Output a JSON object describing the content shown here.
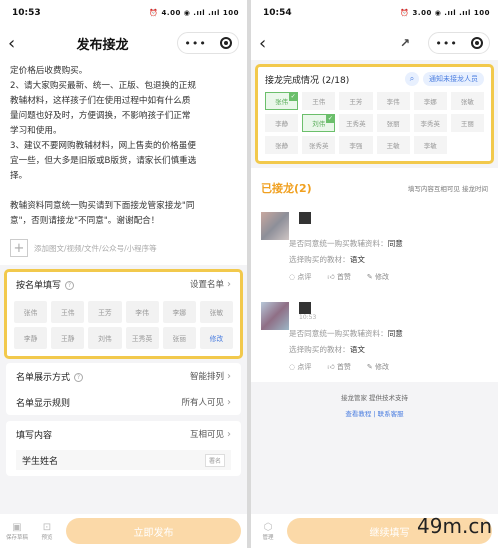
{
  "left": {
    "status": {
      "time": "10:53",
      "icons": "⏰ 4.00 ◉ .ııl .ııl 100"
    },
    "title": "发布接龙",
    "body_lines": [
      "定价格后收费购买。",
      "2、请大家购买最新、统一、正版、包退换的正规",
      "教辅材料，这样孩子们在使用过程中如有什么质",
      "量问题也好及时，方便调换，不影响孩子们正常",
      "学习和使用。",
      "3、建议不要网购教辅材料，网上售卖的价格虽便",
      "宜一些，但大多是旧版或B版货，请家长们慎重选",
      "择。",
      "",
      "教辅资料同意统一购买请到下面接龙管家接龙\"同",
      "意\"，否则请接龙\"不同意\"。谢谢配合！"
    ],
    "attach_label": "添加图文/视频/文件/公众号/小程序等",
    "roster": {
      "label": "按名单填写",
      "action": "设置名单",
      "names": [
        "张伟",
        "王伟",
        "王芳",
        "李伟",
        "李娜",
        "张敏",
        "李静",
        "王静",
        "刘伟",
        "王秀英",
        "张丽",
        "修改"
      ]
    },
    "settings": [
      {
        "label": "名单展示方式",
        "value": "智能排列",
        "help": true
      },
      {
        "label": "名单显示规则",
        "value": "所有人可见",
        "help": false
      }
    ],
    "fill": {
      "label": "填写内容",
      "value": "互相可见",
      "field": "学生姓名",
      "tag": "署名"
    },
    "bottom": {
      "icon1": "保存草稿",
      "icon2": "预览",
      "button": "立即发布"
    }
  },
  "right": {
    "status": {
      "time": "10:54",
      "icons": "⏰ 3.00 ◉ .ııl .ııl 100"
    },
    "panel": {
      "title": "接龙完成情况",
      "count": "(2/18)",
      "notify": "通知未接龙人员",
      "names": [
        "张伟",
        "王伟",
        "王芳",
        "李伟",
        "李娜",
        "张敏",
        "李静",
        "刘伟",
        "王秀英",
        "张丽",
        "李秀英",
        "王丽",
        "张静",
        "张秀英",
        "李强",
        "王敏",
        "李敏"
      ],
      "done": [
        0,
        7
      ]
    },
    "list": {
      "title": "已接龙(2)",
      "right": "填写内容互相可见   接龙时间"
    },
    "entries": [
      {
        "time": "",
        "q1_label": "是否同意统一购买教辅资料：",
        "q1_value": "同意",
        "q2_label": "选择购买的教材：",
        "q2_value": "语文",
        "acts": [
          "点评",
          "首赞",
          "修改"
        ]
      },
      {
        "time": "10:53",
        "q1_label": "是否同意统一购买教辅资料：",
        "q1_value": "同意",
        "q2_label": "选择购买的教材：",
        "q2_value": "语文",
        "acts": [
          "点评",
          "首赞",
          "修改"
        ]
      }
    ],
    "footer": {
      "brand": "接龙管家   提供技术支持",
      "links": "查看教程   |   联系客服"
    },
    "bottom": {
      "icon1": "管理",
      "button": "继续填写"
    }
  },
  "watermark": "49m.cn"
}
